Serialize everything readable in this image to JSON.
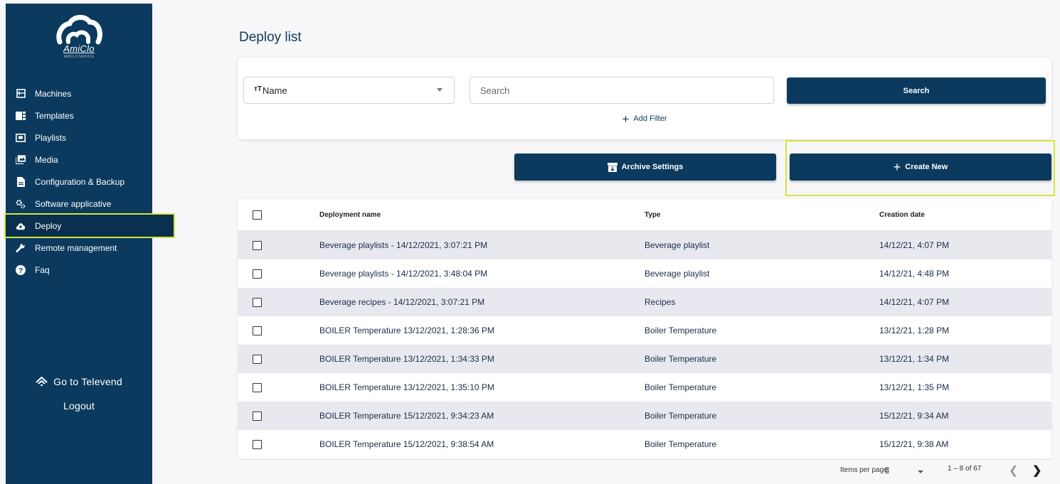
{
  "brand": {
    "name": "AmiClo",
    "tagline": "AMICLO SERVICE"
  },
  "sidebar": {
    "items": [
      {
        "label": "Machines",
        "icon": "machine-icon"
      },
      {
        "label": "Templates",
        "icon": "templates-icon"
      },
      {
        "label": "Playlists",
        "icon": "playlist-icon"
      },
      {
        "label": "Media",
        "icon": "media-icon"
      },
      {
        "label": "Configuration & Backup",
        "icon": "file-icon"
      },
      {
        "label": "Software applicative",
        "icon": "gears-icon"
      },
      {
        "label": "Deploy",
        "icon": "cloud-upload-icon",
        "active": true
      },
      {
        "label": "Remote management",
        "icon": "wrench-icon"
      },
      {
        "label": "Faq",
        "icon": "question-icon"
      }
    ],
    "goto_label": "Go to Televend",
    "logout_label": "Logout"
  },
  "page": {
    "title": "Deploy list"
  },
  "filter": {
    "field_selected": "Name",
    "search_placeholder": "Search",
    "search_button": "Search",
    "add_filter": "Add Filter"
  },
  "actions": {
    "archive": "Archive Settings",
    "create": "Create New"
  },
  "table": {
    "headers": [
      "Deployment name",
      "Type",
      "Creation date"
    ],
    "rows": [
      [
        "Beverage playlists - 14/12/2021, 3:07:21 PM",
        "Beverage playlist",
        "14/12/21, 4:07 PM"
      ],
      [
        "Beverage playlists - 14/12/2021, 3:48:04 PM",
        "Beverage playlist",
        "14/12/21, 4:48 PM"
      ],
      [
        "Beverage recipes - 14/12/2021, 3:07:21 PM",
        "Recipes",
        "14/12/21, 4:07 PM"
      ],
      [
        "BOILER Temperature 13/12/2021, 1:28:36 PM",
        "Boiler Temperature",
        "13/12/21, 1:28 PM"
      ],
      [
        "BOILER Temperature 13/12/2021, 1:34:33 PM",
        "Boiler Temperature",
        "13/12/21, 1:34 PM"
      ],
      [
        "BOILER Temperature 13/12/2021, 1:35:10 PM",
        "Boiler Temperature",
        "13/12/21, 1:35 PM"
      ],
      [
        "BOILER Temperature 15/12/2021, 9:34:23 AM",
        "Boiler Temperature",
        "15/12/21, 9:34 AM"
      ],
      [
        "BOILER Temperature 15/12/2021, 9:38:54 AM",
        "Boiler Temperature",
        "15/12/21, 9:38 AM"
      ]
    ]
  },
  "pagination": {
    "items_per_page_label": "Items per page:",
    "items_per_page": "8",
    "range": "1 – 8 of 67"
  },
  "colors": {
    "primary": "#0b3a5e",
    "highlight": "#d5e43d"
  }
}
